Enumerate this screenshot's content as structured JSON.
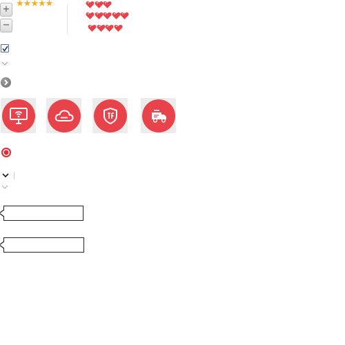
{
  "zoom": {
    "in_label": "+",
    "out_label": "−"
  },
  "rating": {
    "value": 5,
    "max": 5,
    "star_icon": "star-icon",
    "color": "#f2b01e"
  },
  "hearts": {
    "icon": "heart-icon",
    "color": "#e8434a",
    "rows": [
      {
        "count": 3
      },
      {
        "count": 5
      },
      {
        "count": 4
      }
    ]
  },
  "checkbox": {
    "checked": true
  },
  "chevron": {
    "icon": "chevron-down-icon"
  },
  "round_button": {
    "icon": "chevron-right-icon"
  },
  "feature_tiles": [
    {
      "icon": "wifi-monitor-icon"
    },
    {
      "icon": "cloud-icon"
    },
    {
      "icon": "shield-icon"
    },
    {
      "icon": "delivery-truck-icon"
    }
  ],
  "accent_color": "#e8434a",
  "select": {
    "icon": "chevron-down-icon",
    "value": ""
  },
  "callouts": [
    {
      "text": ""
    },
    {
      "text": ""
    }
  ]
}
